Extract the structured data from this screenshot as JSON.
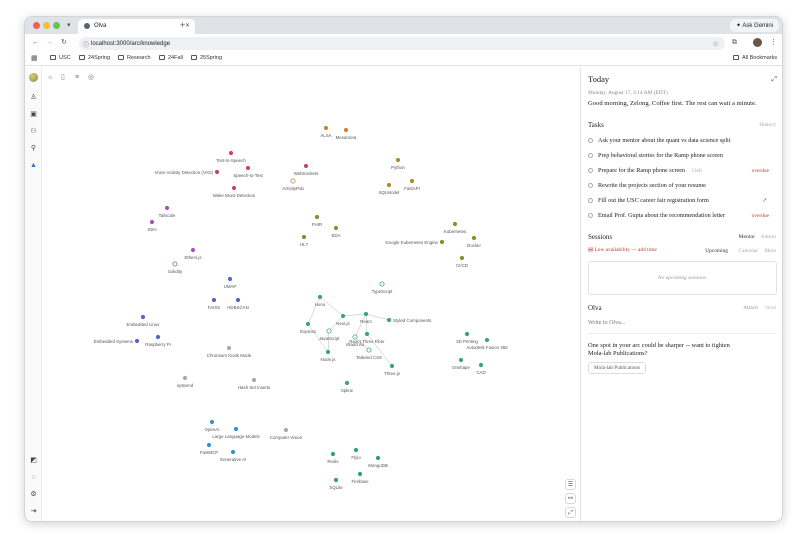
{
  "browser": {
    "tab_title": "Olva",
    "ask_gemini": "Ask Gemini",
    "url": "localhost:3000/arc/knowledge",
    "bookmarks": [
      "USC",
      "24Spring",
      "Research",
      "24Fall",
      "25Spring"
    ],
    "all_bookmarks": "All Bookmarks"
  },
  "graph": {
    "nodes": [
      {
        "label": "ALSA",
        "color": "#c9842f"
      },
      {
        "label": "Mesamora",
        "color": "#c9842f"
      },
      {
        "label": "Text-to-Speech",
        "color": "#c44b56"
      },
      {
        "label": "Voice Activity Detection (VAD)",
        "color": "#c44b56"
      },
      {
        "label": "Speech-to-Text",
        "color": "#c44b56"
      },
      {
        "label": "Wake Word Detection",
        "color": "#c44b56"
      },
      {
        "label": "WebSockets",
        "color": "#c44b56"
      },
      {
        "label": "ActivityPub",
        "color": "#c9842f",
        "hollow": true
      },
      {
        "label": "Python",
        "color": "#b08a2a"
      },
      {
        "label": "FastAPI",
        "color": "#b08a2a"
      },
      {
        "label": "SQLModel",
        "color": "#b08a2a"
      },
      {
        "label": "Tailscale",
        "color": "#a754b8"
      },
      {
        "label": "SSH",
        "color": "#a754b8"
      },
      {
        "label": "Ethers.js",
        "color": "#a754b8"
      },
      {
        "label": "Solidity",
        "color": "#a754b8",
        "hollow": true
      },
      {
        "label": "FHIR",
        "color": "#8f8a2a"
      },
      {
        "label": "EDA",
        "color": "#8f8a2a"
      },
      {
        "label": "HL7",
        "color": "#8f8a2a"
      },
      {
        "label": "Kubernetes",
        "color": "#8f8a2a"
      },
      {
        "label": "Google Kubernetes Engine",
        "color": "#8f8a2a"
      },
      {
        "label": "Docker",
        "color": "#8f8a2a"
      },
      {
        "label": "CI/CD",
        "color": "#8f8a2a"
      },
      {
        "label": "UMAP",
        "color": "#5566c4"
      },
      {
        "label": "FAISS",
        "color": "#5566c4"
      },
      {
        "label": "HDBSCAN",
        "color": "#5566c4"
      },
      {
        "label": "Embedded Linux",
        "color": "#5566c4"
      },
      {
        "label": "Embedded Systems",
        "color": "#5566c4"
      },
      {
        "label": "Raspberry Pi",
        "color": "#5566c4"
      },
      {
        "label": "Chromium Kiosk Mode",
        "color": "#a9a9a9"
      },
      {
        "label": "systemd",
        "color": "#a9a9a9"
      },
      {
        "label": "Hash Set Inserts",
        "color": "#a9a9a9"
      },
      {
        "label": "TypeScript",
        "color": "#3aa86b",
        "hollow": true
      },
      {
        "label": "Hono",
        "color": "#3aa86b"
      },
      {
        "label": "Next.js",
        "color": "#3aa86b"
      },
      {
        "label": "React",
        "color": "#3aa86b"
      },
      {
        "label": "Styled Components",
        "color": "#3aa86b"
      },
      {
        "label": "Express",
        "color": "#3aa86b"
      },
      {
        "label": "JavaScript",
        "color": "#3aa86b",
        "hollow": true
      },
      {
        "label": "shadcn/ui",
        "color": "#3aa86b",
        "hollow": true
      },
      {
        "label": "React Three Fiber",
        "color": "#3aa86b"
      },
      {
        "label": "Tailwind CSS",
        "color": "#3aa86b",
        "hollow": true
      },
      {
        "label": "Node.js",
        "color": "#3aa86b"
      },
      {
        "label": "Three.js",
        "color": "#3aa86b"
      },
      {
        "label": "Spline",
        "color": "#3aa86b"
      },
      {
        "label": "3D Printing",
        "color": "#3aa86b"
      },
      {
        "label": "Autodesk Fusion 360",
        "color": "#3aa86b"
      },
      {
        "label": "Onshape",
        "color": "#3aa86b"
      },
      {
        "label": "CAD",
        "color": "#3aa86b"
      },
      {
        "label": "OpenAI",
        "color": "#3b8fd0"
      },
      {
        "label": "Large Language Models",
        "color": "#3b8fd0"
      },
      {
        "label": "FastMCP",
        "color": "#3b8fd0"
      },
      {
        "label": "Generative AI",
        "color": "#3b8fd0"
      },
      {
        "label": "Computer Vision",
        "color": "#a9a9a9"
      },
      {
        "label": "Flyio",
        "color": "#2e9e86"
      },
      {
        "label": "Redis",
        "color": "#2e9e86"
      },
      {
        "label": "MongoDB",
        "color": "#2e9e86"
      },
      {
        "label": "Firebase",
        "color": "#2e9e86"
      },
      {
        "label": "SQLite",
        "color": "#2e9e86"
      }
    ]
  },
  "panel": {
    "title": "Today",
    "date": "Monday, August 17, 3:14 AM (EDT)",
    "greeting": "Good morning, Zelong. Coffee first. The rest can wait a minute.",
    "tasks_heading": "Tasks",
    "history": "History",
    "tasks": [
      {
        "text": "Ask your mentor about the quant vs data science split",
        "meta": ""
      },
      {
        "text": "Prep behavioral stories for the Ramp phone screen",
        "meta": ""
      },
      {
        "text": "Prepare for the Ramp phone screen",
        "left": "3 left",
        "meta": "overdue"
      },
      {
        "text": "Rewrite the projects section of your resume",
        "meta": ""
      },
      {
        "text": "Fill out the USC career fair registration form",
        "meta": "link"
      },
      {
        "text": "Email Prof. Gupta about the recommendation letter",
        "meta": "overdue"
      }
    ],
    "sessions_heading": "Sessions",
    "mentor": "Mentor",
    "admin": "Admin",
    "low_availability": "Low availability",
    "add_time": "add time",
    "upcoming": "Upcoming",
    "calendar": "Calendar",
    "more": "More",
    "no_sessions": "No upcoming sessions.",
    "olva_heading": "Olva",
    "attach": "Attach",
    "send": "Send",
    "input_placeholder": "Write to Olva...",
    "suggestion": "One spot in your arc could be sharper -- want to tighten Mola-lab Publications?",
    "chip": "Mola-lab Publications"
  }
}
